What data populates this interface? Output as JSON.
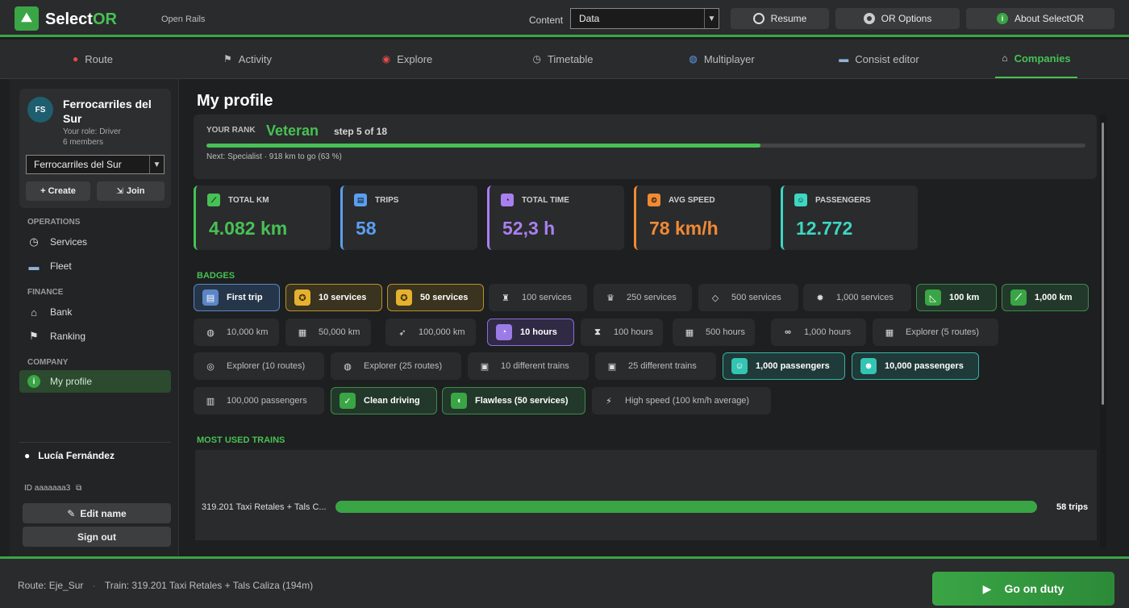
{
  "header": {
    "app_name_prefix": "Select",
    "app_name_suffix": "OR",
    "subtitle": "Open Rails",
    "content_label": "Content",
    "content_value": "Data",
    "buttons": [
      {
        "label": "Resume",
        "icon": "resume-icon"
      },
      {
        "label": "OR Options",
        "icon": "options-icon"
      },
      {
        "label": "About SelectOR",
        "icon": "info-icon"
      }
    ]
  },
  "tabs": [
    {
      "label": "Route",
      "icon": "pin-icon",
      "active": false
    },
    {
      "label": "Activity",
      "icon": "flag-icon",
      "active": false
    },
    {
      "label": "Explore",
      "icon": "explore-icon",
      "active": false
    },
    {
      "label": "Timetable",
      "icon": "clock-icon",
      "active": false
    },
    {
      "label": "Multiplayer",
      "icon": "globe-icon",
      "active": false
    },
    {
      "label": "Consist editor",
      "icon": "train-icon",
      "active": false
    },
    {
      "label": "Companies",
      "icon": "building-icon",
      "active": true
    }
  ],
  "sidebar": {
    "company": {
      "avatar_text": "FS",
      "name": "Ferrocarriles del Sur",
      "role": "Your role: Driver",
      "members": "6 members",
      "select_value": "Ferrocarriles del Sur",
      "create_label": "+ Create",
      "join_label": "Join"
    },
    "sections": [
      {
        "label": "OPERATIONS",
        "items": [
          {
            "label": "Services",
            "icon": "clock-icon"
          },
          {
            "label": "Fleet",
            "icon": "train-icon"
          }
        ]
      },
      {
        "label": "FINANCE",
        "items": [
          {
            "label": "Bank",
            "icon": "bank-icon"
          },
          {
            "label": "Ranking",
            "icon": "flag-icon"
          }
        ]
      },
      {
        "label": "COMPANY",
        "items": [
          {
            "label": "My profile",
            "icon": "info-icon",
            "active": true
          }
        ]
      }
    ],
    "user": {
      "name": "Lucía Fernández",
      "id": "ID aaaaaaa3",
      "edit_label": "Edit name",
      "signout_label": "Sign out"
    }
  },
  "main": {
    "title": "My profile",
    "rank": {
      "label": "YOUR RANK",
      "value": "Veteran",
      "step": "step 5 of 18",
      "progress_pct": 63,
      "next": "Next: Specialist · 918 km to go (63 %)"
    },
    "stats": [
      {
        "label": "TOTAL KM",
        "value": "4.082 km",
        "color": "#47c155",
        "icon": "rail-icon"
      },
      {
        "label": "TRIPS",
        "value": "58",
        "color": "#5b9ef0",
        "icon": "ticket-icon"
      },
      {
        "label": "TOTAL TIME",
        "value": "52,3 h",
        "color": "#a880f0",
        "icon": "stopwatch-icon"
      },
      {
        "label": "AVG SPEED",
        "value": "78 km/h",
        "color": "#f08a35",
        "icon": "speed-icon"
      },
      {
        "label": "PASSENGERS",
        "value": "12.772",
        "color": "#3ed6c2",
        "icon": "person-icon"
      }
    ],
    "badges_label": "BADGES",
    "badges": [
      {
        "label": "First trip",
        "style": "blue",
        "icon": "ticket-icon"
      },
      {
        "label": "10 services",
        "style": "gold",
        "icon": "medal-icon"
      },
      {
        "label": "50 services",
        "style": "gold",
        "icon": "medal-icon"
      },
      {
        "label": "100 services",
        "style": "locked",
        "icon": "trophy-icon"
      },
      {
        "label": "250 services",
        "style": "locked",
        "icon": "crown-icon"
      },
      {
        "label": "500 services",
        "style": "locked",
        "icon": "diamond-icon"
      },
      {
        "label": "1,000 services",
        "style": "locked",
        "icon": "sun-icon"
      },
      {
        "label": "100 km",
        "style": "green",
        "icon": "ruler-icon"
      },
      {
        "label": "1,000 km",
        "style": "green",
        "icon": "rail-icon"
      },
      {
        "label": "10,000 km",
        "style": "locked",
        "icon": "globe-icon"
      },
      {
        "label": "50,000 km",
        "style": "locked",
        "icon": "map-icon"
      },
      {
        "label": "100,000 km",
        "style": "locked",
        "icon": "rocket-icon"
      },
      {
        "label": "10 hours",
        "style": "purple",
        "icon": "stopwatch-icon"
      },
      {
        "label": "100 hours",
        "style": "locked",
        "icon": "hourglass-icon"
      },
      {
        "label": "500 hours",
        "style": "locked",
        "icon": "calendar-icon"
      },
      {
        "label": "1,000 hours",
        "style": "locked",
        "icon": "infinity-icon"
      },
      {
        "label": "Explorer (5 routes)",
        "style": "locked",
        "icon": "map-icon"
      },
      {
        "label": "Explorer (10 routes)",
        "style": "locked",
        "icon": "compass-icon"
      },
      {
        "label": "Explorer (25 routes)",
        "style": "locked",
        "icon": "globe-icon"
      },
      {
        "label": "10 different trains",
        "style": "locked",
        "icon": "train-icon"
      },
      {
        "label": "25 different trains",
        "style": "locked",
        "icon": "train-icon"
      },
      {
        "label": "1,000 passengers",
        "style": "teal",
        "icon": "person-icon"
      },
      {
        "label": "10,000 passengers",
        "style": "teal",
        "icon": "people-icon"
      },
      {
        "label": "100,000 passengers",
        "style": "locked",
        "icon": "building-icon"
      },
      {
        "label": "Clean driving",
        "style": "green",
        "icon": "check-icon"
      },
      {
        "label": "Flawless (50 services)",
        "style": "green",
        "icon": "shield-icon"
      },
      {
        "label": "High speed (100 km/h average)",
        "style": "locked",
        "icon": "bolt-icon"
      }
    ],
    "trains_label": "MOST USED TRAINS",
    "trains": [
      {
        "name": "319.201 Taxi Retales + Tals C...",
        "trips": "58 trips",
        "fraction": 1.0
      }
    ]
  },
  "footer": {
    "route": "Route: Eje_Sur",
    "train": "Train: 319.201 Taxi Retales + Tals Caliza (194m)",
    "go_label": "Go on duty"
  }
}
